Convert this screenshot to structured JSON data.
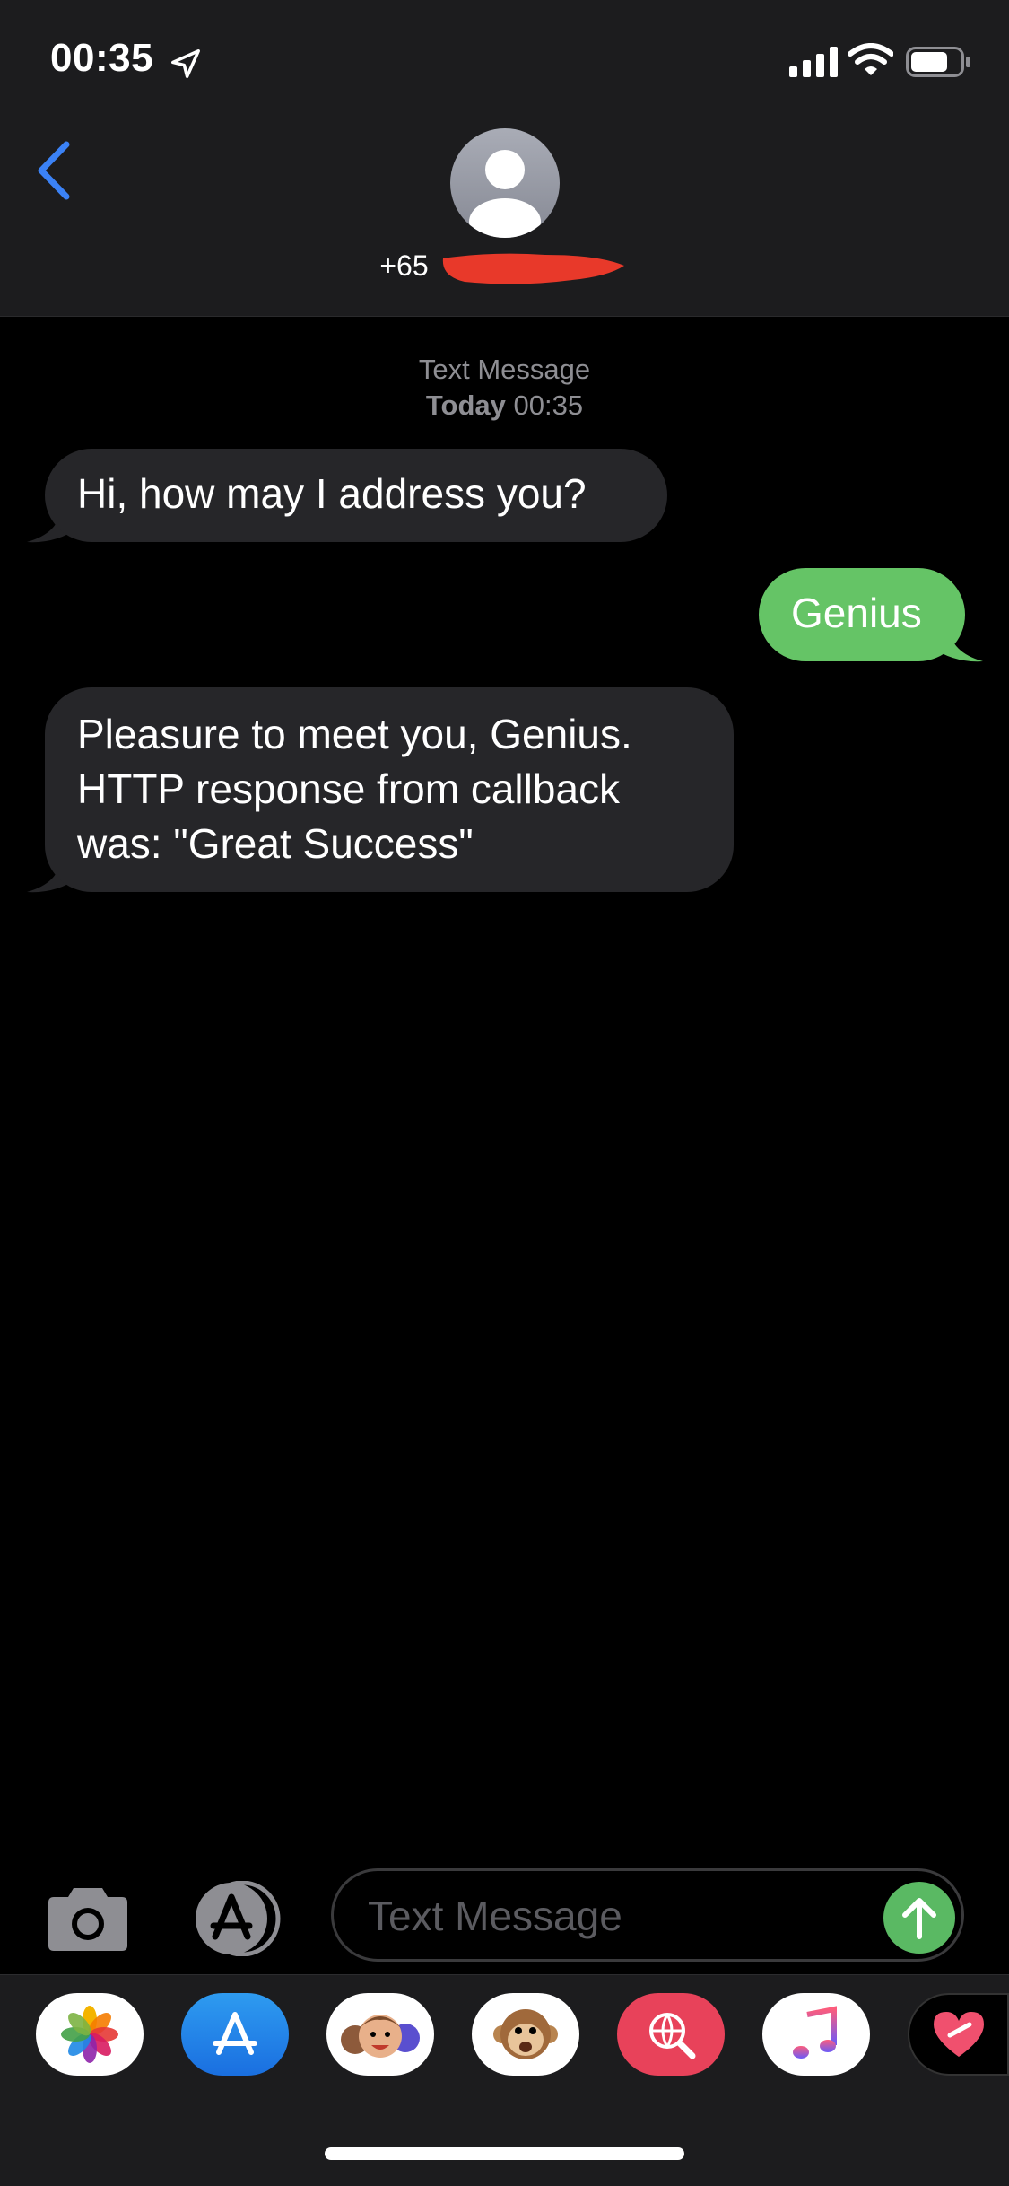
{
  "status_bar": {
    "time": "00:35",
    "location_icon": "location-arrow-icon",
    "signal_icon": "cellular-signal-icon",
    "wifi_icon": "wifi-icon",
    "battery_icon": "battery-icon"
  },
  "header": {
    "back_icon": "chevron-left-icon",
    "avatar_icon": "person-silhouette-icon",
    "contact_prefix": "+65",
    "contact_redacted": true
  },
  "conversation": {
    "service_label": "Text Message",
    "date_label": "Today",
    "time_label": "00:35",
    "messages": [
      {
        "direction": "incoming",
        "text": "Hi, how may I address you?"
      },
      {
        "direction": "outgoing",
        "text": "Genius"
      },
      {
        "direction": "incoming",
        "text": "Pleasure to meet you, Genius.\nHTTP response from callback\nwas: \"Great Success\""
      }
    ]
  },
  "composer": {
    "placeholder": "Text Message",
    "value": "",
    "camera_icon": "camera-icon",
    "apps_icon": "app-store-icon",
    "send_icon": "arrow-up-icon"
  },
  "app_drawer": {
    "apps": [
      {
        "name": "Photos",
        "icon": "photos-icon"
      },
      {
        "name": "App Store",
        "icon": "app-store-icon"
      },
      {
        "name": "Memoji",
        "icon": "memoji-icon"
      },
      {
        "name": "Animoji",
        "icon": "monkey-icon"
      },
      {
        "name": "Search",
        "icon": "globe-search-icon"
      },
      {
        "name": "Music",
        "icon": "music-note-icon"
      },
      {
        "name": "Digital Touch",
        "icon": "heart-icon"
      }
    ]
  },
  "colors": {
    "header_bg": "#1c1c1e",
    "incoming_bubble": "#262629",
    "outgoing_bubble": "#65c466",
    "accent_blue": "#3b82f6",
    "send_green": "#5ab963",
    "meta_gray": "#8e8e93"
  }
}
